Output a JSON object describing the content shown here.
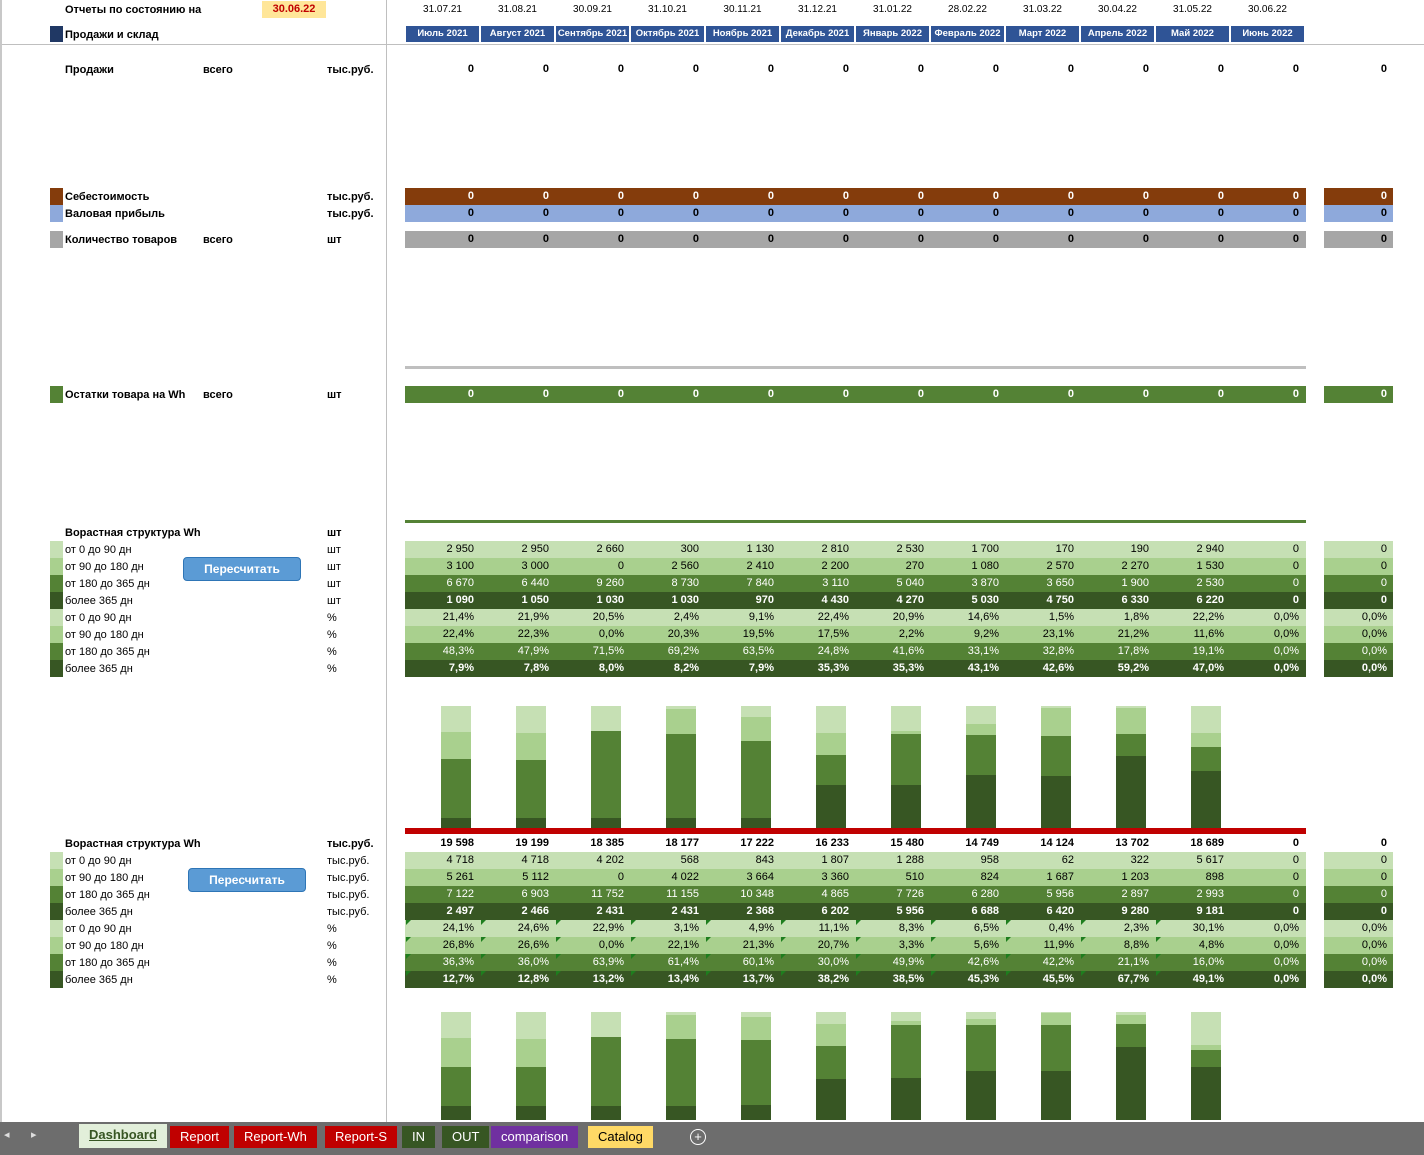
{
  "header": {
    "report_label": "Отчеты по состоянию на",
    "report_date": "30.06.22",
    "section_title": "Продажи и склад"
  },
  "dates": [
    "31.07.21",
    "31.08.21",
    "30.09.21",
    "31.10.21",
    "30.11.21",
    "31.12.21",
    "31.01.22",
    "28.02.22",
    "31.03.22",
    "30.04.22",
    "31.05.22",
    "30.06.22"
  ],
  "months": [
    "Июль 2021",
    "Август 2021",
    "Сентябрь 2021",
    "Октябрь 2021",
    "Ноябрь 2021",
    "Декабрь 2021",
    "Январь 2022",
    "Февраль 2022",
    "Март 2022",
    "Апрель 2022",
    "Май 2022",
    "Июнь 2022"
  ],
  "summary_rows": [
    {
      "label": "Продажи",
      "sub": "всего",
      "unit": "тыс.руб.",
      "values": [
        "0",
        "0",
        "0",
        "0",
        "0",
        "0",
        "0",
        "0",
        "0",
        "0",
        "0",
        "0"
      ],
      "total": "0",
      "color": "",
      "swatch": "",
      "top": 61
    },
    {
      "label": "Себестоимость",
      "sub": "",
      "unit": "тыс.руб.",
      "values": [
        "0",
        "0",
        "0",
        "0",
        "0",
        "0",
        "0",
        "0",
        "0",
        "0",
        "0",
        "0"
      ],
      "total": "0",
      "color": "#843c0c",
      "swatch": "#843c0c",
      "top": 188
    },
    {
      "label": "Валовая прибыль",
      "sub": "",
      "unit": "тыс.руб.",
      "values": [
        "0",
        "0",
        "0",
        "0",
        "0",
        "0",
        "0",
        "0",
        "0",
        "0",
        "0",
        "0"
      ],
      "total": "0",
      "color": "#8ea9db",
      "swatch": "#8ea9db",
      "top": 205
    },
    {
      "label": "Количество товаров",
      "sub": "всего",
      "unit": "шт",
      "values": [
        "0",
        "0",
        "0",
        "0",
        "0",
        "0",
        "0",
        "0",
        "0",
        "0",
        "0",
        "0"
      ],
      "total": "0",
      "color": "#a6a6a6",
      "swatch": "#a6a6a6",
      "top": 231
    },
    {
      "label": "Остатки товара на Wh",
      "sub": "всего",
      "unit": "шт",
      "values": [
        "0",
        "0",
        "0",
        "0",
        "0",
        "0",
        "0",
        "0",
        "0",
        "0",
        "0",
        "0"
      ],
      "total": "0",
      "color": "#548235",
      "swatch": "#548235",
      "top": 386
    }
  ],
  "colors": {
    "band1": "#c6e0b4",
    "band2": "#a9d08e",
    "band3": "#548235",
    "band4": "#375623",
    "header_blue": "#2f5496",
    "date_highlight": "#ffe699",
    "red_line": "#c00000"
  },
  "age_qty": {
    "title": "Ворастная структура Wh",
    "title_unit": "шт",
    "button": "Пересчитать",
    "rows": [
      {
        "label": "от 0 до 90 дн",
        "unit": "шт",
        "values": [
          "2 950",
          "2 950",
          "2 660",
          "300",
          "1 130",
          "2 810",
          "2 530",
          "1 700",
          "170",
          "190",
          "2 940",
          "0"
        ],
        "total": "0"
      },
      {
        "label": "от 90 до 180 дн",
        "unit": "шт",
        "values": [
          "3 100",
          "3 000",
          "0",
          "2 560",
          "2 410",
          "2 200",
          "270",
          "1 080",
          "2 570",
          "2 270",
          "1 530",
          "0"
        ],
        "total": "0"
      },
      {
        "label": "от 180 до 365 дн",
        "unit": "шт",
        "values": [
          "6 670",
          "6 440",
          "9 260",
          "8 730",
          "7 840",
          "3 110",
          "5 040",
          "3 870",
          "3 650",
          "1 900",
          "2 530",
          "0"
        ],
        "total": "0"
      },
      {
        "label": "более 365 дн",
        "unit": "шт",
        "values": [
          "1 090",
          "1 050",
          "1 030",
          "1 030",
          "970",
          "4 430",
          "4 270",
          "5 030",
          "4 750",
          "6 330",
          "6 220",
          "0"
        ],
        "total": "0"
      },
      {
        "label": "от 0 до 90 дн",
        "unit": "%",
        "values": [
          "21,4%",
          "21,9%",
          "20,5%",
          "2,4%",
          "9,1%",
          "22,4%",
          "20,9%",
          "14,6%",
          "1,5%",
          "1,8%",
          "22,2%",
          "0,0%"
        ],
        "total": "0,0%"
      },
      {
        "label": "от 90 до 180 дн",
        "unit": "%",
        "values": [
          "22,4%",
          "22,3%",
          "0,0%",
          "20,3%",
          "19,5%",
          "17,5%",
          "2,2%",
          "9,2%",
          "23,1%",
          "21,2%",
          "11,6%",
          "0,0%"
        ],
        "total": "0,0%"
      },
      {
        "label": "от 180 до 365 дн",
        "unit": "%",
        "values": [
          "48,3%",
          "47,9%",
          "71,5%",
          "69,2%",
          "63,5%",
          "24,8%",
          "41,6%",
          "33,1%",
          "32,8%",
          "17,8%",
          "19,1%",
          "0,0%"
        ],
        "total": "0,0%"
      },
      {
        "label": "более 365 дн",
        "unit": "%",
        "values": [
          "7,9%",
          "7,8%",
          "8,0%",
          "8,2%",
          "7,9%",
          "35,3%",
          "35,3%",
          "43,1%",
          "42,6%",
          "59,2%",
          "47,0%",
          "0,0%"
        ],
        "total": "0,0%"
      }
    ]
  },
  "age_rub": {
    "title": "Ворастная структура Wh",
    "title_unit": "тыс.руб.",
    "button": "Пересчитать",
    "totals": [
      "19 598",
      "19 199",
      "18 385",
      "18 177",
      "17 222",
      "16 233",
      "15 480",
      "14 749",
      "14 124",
      "13 702",
      "18 689",
      "0"
    ],
    "totals_total": "0",
    "rows": [
      {
        "label": "от 0 до 90 дн",
        "unit": "тыс.руб.",
        "values": [
          "4 718",
          "4 718",
          "4 202",
          "568",
          "843",
          "1 807",
          "1 288",
          "958",
          "62",
          "322",
          "5 617",
          "0"
        ],
        "total": "0"
      },
      {
        "label": "от 90 до 180 дн",
        "unit": "тыс.руб.",
        "values": [
          "5 261",
          "5 112",
          "0",
          "4 022",
          "3 664",
          "3 360",
          "510",
          "824",
          "1 687",
          "1 203",
          "898",
          "0"
        ],
        "total": "0"
      },
      {
        "label": "от 180 до 365 дн",
        "unit": "тыс.руб.",
        "values": [
          "7 122",
          "6 903",
          "11 752",
          "11 155",
          "10 348",
          "4 865",
          "7 726",
          "6 280",
          "5 956",
          "2 897",
          "2 993",
          "0"
        ],
        "total": "0"
      },
      {
        "label": "более 365 дн",
        "unit": "тыс.руб.",
        "values": [
          "2 497",
          "2 466",
          "2 431",
          "2 431",
          "2 368",
          "6 202",
          "5 956",
          "6 688",
          "6 420",
          "9 280",
          "9 181",
          "0"
        ],
        "total": "0"
      },
      {
        "label": "от 0 до 90 дн",
        "unit": "%",
        "values": [
          "24,1%",
          "24,6%",
          "22,9%",
          "3,1%",
          "4,9%",
          "11,1%",
          "8,3%",
          "6,5%",
          "0,4%",
          "2,3%",
          "30,1%",
          "0,0%"
        ],
        "total": "0,0%"
      },
      {
        "label": "от 90 до 180 дн",
        "unit": "%",
        "values": [
          "26,8%",
          "26,6%",
          "0,0%",
          "22,1%",
          "21,3%",
          "20,7%",
          "3,3%",
          "5,6%",
          "11,9%",
          "8,8%",
          "4,8%",
          "0,0%"
        ],
        "total": "0,0%"
      },
      {
        "label": "от 180 до 365 дн",
        "unit": "%",
        "values": [
          "36,3%",
          "36,0%",
          "63,9%",
          "61,4%",
          "60,1%",
          "30,0%",
          "49,9%",
          "42,6%",
          "42,2%",
          "21,1%",
          "16,0%",
          "0,0%"
        ],
        "total": "0,0%"
      },
      {
        "label": "более 365 дн",
        "unit": "%",
        "values": [
          "12,7%",
          "12,8%",
          "13,2%",
          "13,4%",
          "13,7%",
          "38,2%",
          "38,5%",
          "45,3%",
          "45,5%",
          "67,7%",
          "49,1%",
          "0,0%"
        ],
        "total": "0,0%"
      }
    ]
  },
  "chart_data": [
    {
      "type": "bar",
      "stacked": true,
      "percent": true,
      "categories": [
        "Июль 2021",
        "Август 2021",
        "Сентябрь 2021",
        "Октябрь 2021",
        "Ноябрь 2021",
        "Декабрь 2021",
        "Январь 2022",
        "Февраль 2022",
        "Март 2022",
        "Апрель 2022",
        "Май 2022"
      ],
      "series": [
        {
          "name": "более 365 дн",
          "values": [
            7.9,
            7.8,
            8.0,
            8.2,
            7.9,
            35.3,
            35.3,
            43.1,
            42.6,
            59.2,
            47.0
          ]
        },
        {
          "name": "от 180 до 365 дн",
          "values": [
            48.3,
            47.9,
            71.5,
            69.2,
            63.5,
            24.8,
            41.6,
            33.1,
            32.8,
            17.8,
            19.1
          ]
        },
        {
          "name": "от 90 до 180 дн",
          "values": [
            22.4,
            22.3,
            0.0,
            20.3,
            19.5,
            17.5,
            2.2,
            9.2,
            23.1,
            21.2,
            11.6
          ]
        },
        {
          "name": "от 0 до 90 дн",
          "values": [
            21.4,
            21.9,
            20.5,
            2.4,
            9.1,
            22.4,
            20.9,
            14.6,
            1.5,
            1.8,
            22.2
          ]
        }
      ]
    },
    {
      "type": "bar",
      "stacked": true,
      "percent": true,
      "categories": [
        "Июль 2021",
        "Август 2021",
        "Сентябрь 2021",
        "Октябрь 2021",
        "Ноябрь 2021",
        "Декабрь 2021",
        "Январь 2022",
        "Февраль 2022",
        "Март 2022",
        "Апрель 2022",
        "Май 2022"
      ],
      "series": [
        {
          "name": "более 365 дн",
          "values": [
            12.7,
            12.8,
            13.2,
            13.4,
            13.7,
            38.2,
            38.5,
            45.3,
            45.5,
            67.7,
            49.1
          ]
        },
        {
          "name": "от 180 до 365 дн",
          "values": [
            36.3,
            36.0,
            63.9,
            61.4,
            60.1,
            30.0,
            49.9,
            42.6,
            42.2,
            21.1,
            16.0
          ]
        },
        {
          "name": "от 90 до 180 дн",
          "values": [
            26.8,
            26.6,
            0.0,
            22.1,
            21.3,
            20.7,
            3.3,
            5.6,
            11.9,
            8.8,
            4.8
          ]
        },
        {
          "name": "от 0 до 90 дн",
          "values": [
            24.1,
            24.6,
            22.9,
            3.1,
            4.9,
            11.1,
            8.3,
            6.5,
            0.4,
            2.3,
            30.1
          ]
        }
      ]
    }
  ],
  "tabs": [
    {
      "label": "Dashboard",
      "bg": "#e2efda",
      "fg": "#375623",
      "active": true
    },
    {
      "label": "Report",
      "bg": "#c00000",
      "fg": "#ffffff"
    },
    {
      "label": "Report-Wh",
      "bg": "#c00000",
      "fg": "#ffffff"
    },
    {
      "label": "Report-S",
      "bg": "#c00000",
      "fg": "#ffffff"
    },
    {
      "label": "IN",
      "bg": "#375623",
      "fg": "#ffffff"
    },
    {
      "label": "OUT",
      "bg": "#375623",
      "fg": "#ffffff"
    },
    {
      "label": "comparison",
      "bg": "#7030a0",
      "fg": "#ffffff"
    },
    {
      "label": "Catalog",
      "bg": "#ffd966",
      "fg": "#000000"
    }
  ],
  "icons": {
    "nav_prev": "chevron-left-icon",
    "nav_next": "chevron-right-icon",
    "add_sheet": "plus-circle-icon"
  }
}
